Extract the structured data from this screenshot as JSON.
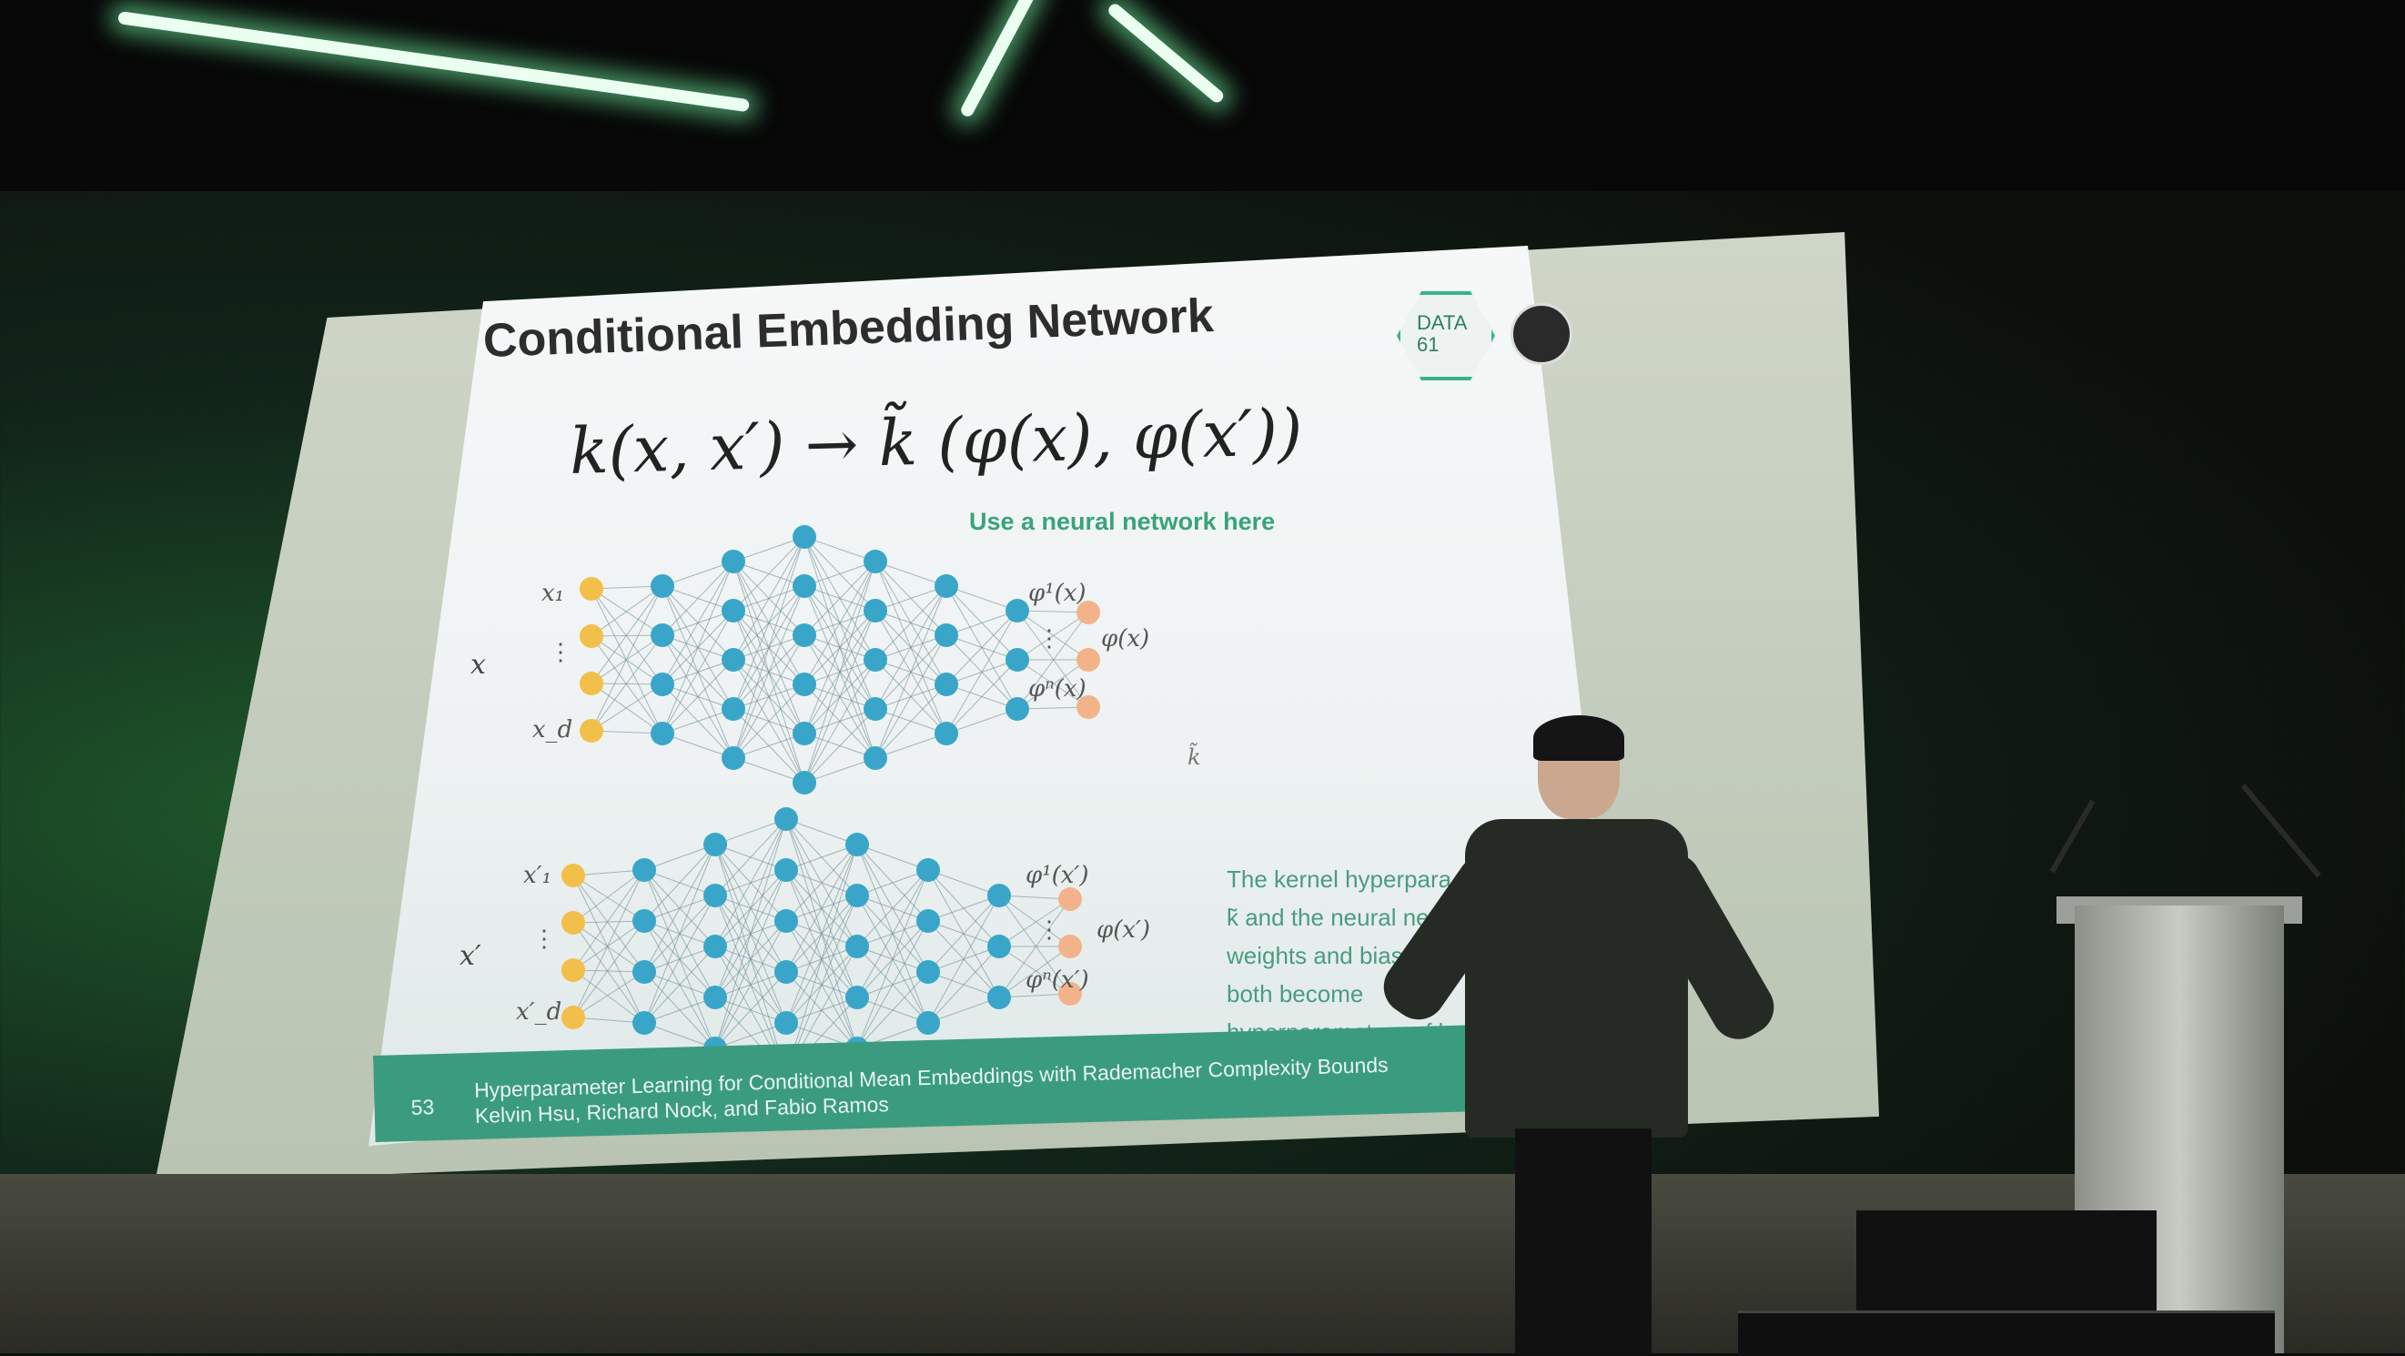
{
  "slide": {
    "title": "Conditional Embedding Network",
    "formula": "k(x, x′) → k̃ (φ(x), φ(x′))",
    "annotation": "Use a neural network here",
    "logo_text_line1": "DATA",
    "logo_text_line2": "61",
    "network_top": {
      "group_label": "x",
      "input_labels": [
        "x₁",
        "⋮",
        "x_d"
      ],
      "output_labels": [
        "φ¹(x)",
        "⋮",
        "φⁿ(x)"
      ],
      "output_group_label": "φ(x)"
    },
    "network_bottom": {
      "group_label": "x′",
      "input_labels": [
        "x′₁",
        "⋮",
        "x′_d"
      ],
      "output_labels": [
        "φ¹(x′)",
        "⋮",
        "φⁿ(x′)"
      ],
      "output_group_label": "φ(x′)"
    },
    "kernel_label": "k̃",
    "side_text_lines": [
      "The kernel hyperpara",
      "k̃ and the neural net",
      "weights and biases",
      "both become",
      "hyperparameters of k"
    ],
    "footer": {
      "slide_number": "53",
      "line1": "Hyperparameter Learning for Conditional Mean Embeddings with Rademacher Complexity Bounds",
      "line2": "Kelvin Hsu, Richard Nock, and Fabio Ramos"
    }
  },
  "colors": {
    "accent_green": "#3aa37a",
    "node_yellow": "#f2c04a",
    "node_blue": "#39a6c9",
    "node_orange": "#f3b38a"
  }
}
